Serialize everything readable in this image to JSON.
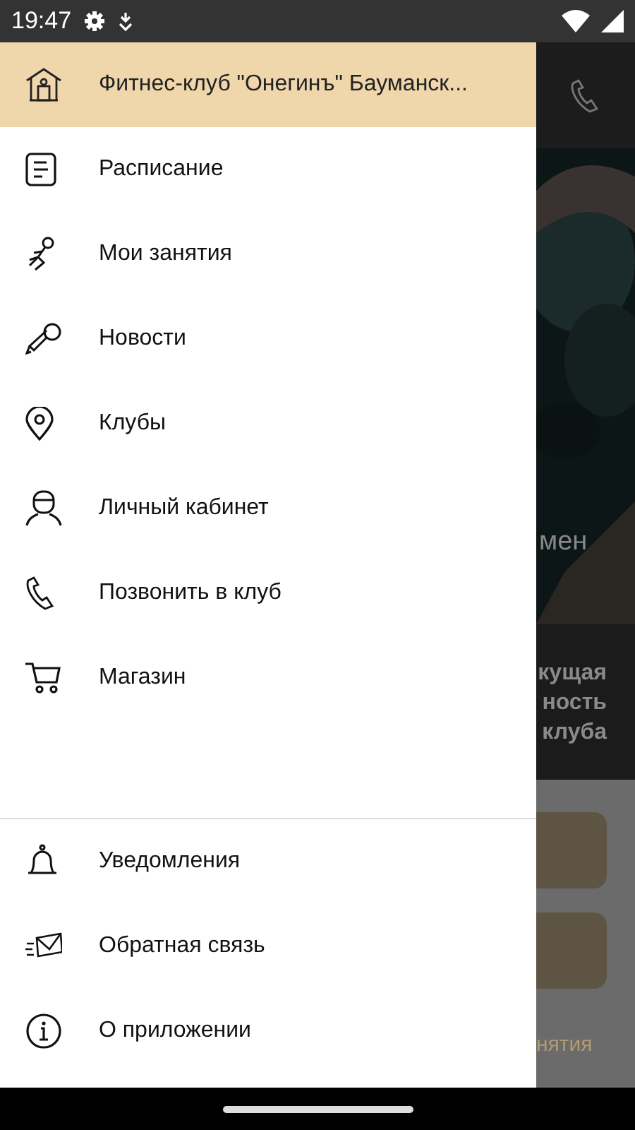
{
  "status_bar": {
    "time": "19:47"
  },
  "drawer": {
    "club": {
      "name": "Фитнес-клуб \"Онегинъ\" Бауманск..."
    },
    "menu_items": [
      {
        "label": "Расписание"
      },
      {
        "label": "Мои занятия"
      },
      {
        "label": "Новости"
      },
      {
        "label": "Клубы"
      },
      {
        "label": "Личный кабинет"
      },
      {
        "label": "Позвонить в клуб"
      },
      {
        "label": "Магазин"
      }
    ],
    "footer_items": [
      {
        "label": "Уведомления"
      },
      {
        "label": "Обратная связь"
      },
      {
        "label": "О приложении"
      }
    ]
  },
  "background": {
    "banner_text": "мен",
    "caption_lines": [
      "кущая",
      "ность",
      "клуба"
    ],
    "bottom_text": "нятия"
  }
}
